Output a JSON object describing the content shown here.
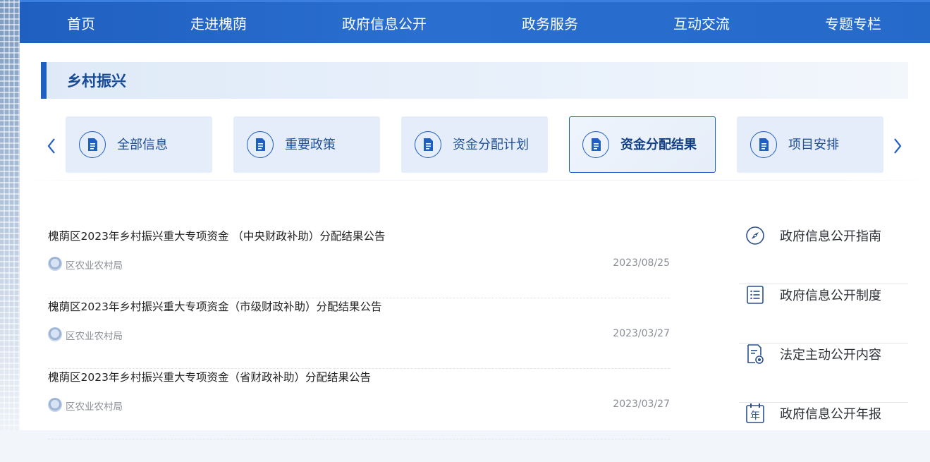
{
  "nav": {
    "items": [
      {
        "label": "首页"
      },
      {
        "label": "走进槐荫"
      },
      {
        "label": "政府信息公开"
      },
      {
        "label": "政务服务"
      },
      {
        "label": "互动交流"
      },
      {
        "label": "专题专栏"
      }
    ]
  },
  "section": {
    "title": "乡村振兴"
  },
  "tabs": [
    {
      "label": "全部信息",
      "icon": "document-icon",
      "active": false
    },
    {
      "label": "重要政策",
      "icon": "document-icon",
      "active": false
    },
    {
      "label": "资金分配计划",
      "icon": "document-icon",
      "active": false
    },
    {
      "label": "资金分配结果",
      "icon": "document-icon",
      "active": true
    },
    {
      "label": "项目安排",
      "icon": "document-icon",
      "active": false
    }
  ],
  "articles": [
    {
      "title": "槐荫区2023年乡村振兴重大专项资金 （中央财政补助）分配结果公告",
      "dept": "区农业农村局",
      "date": "2023/08/25"
    },
    {
      "title": "槐荫区2023年乡村振兴重大专项资金（市级财政补助）分配结果公告",
      "dept": "区农业农村局",
      "date": "2023/03/27"
    },
    {
      "title": "槐荫区2023年乡村振兴重大专项资金（省财政补助）分配结果公告",
      "dept": "区农业农村局",
      "date": "2023/03/27"
    }
  ],
  "sidebar": {
    "items": [
      {
        "label": "政府信息公开指南",
        "icon": "compass-icon"
      },
      {
        "label": "政府信息公开制度",
        "icon": "list-icon"
      },
      {
        "label": "法定主动公开内容",
        "icon": "document-badge-icon"
      },
      {
        "label": "政府信息公开年报",
        "icon": "calendar-year-icon"
      }
    ]
  },
  "colors": {
    "brand": "#1f5fbf",
    "nav_text": "#ffffff",
    "tab_bg": "#e4edf9",
    "meta_text": "#8a8f98"
  }
}
